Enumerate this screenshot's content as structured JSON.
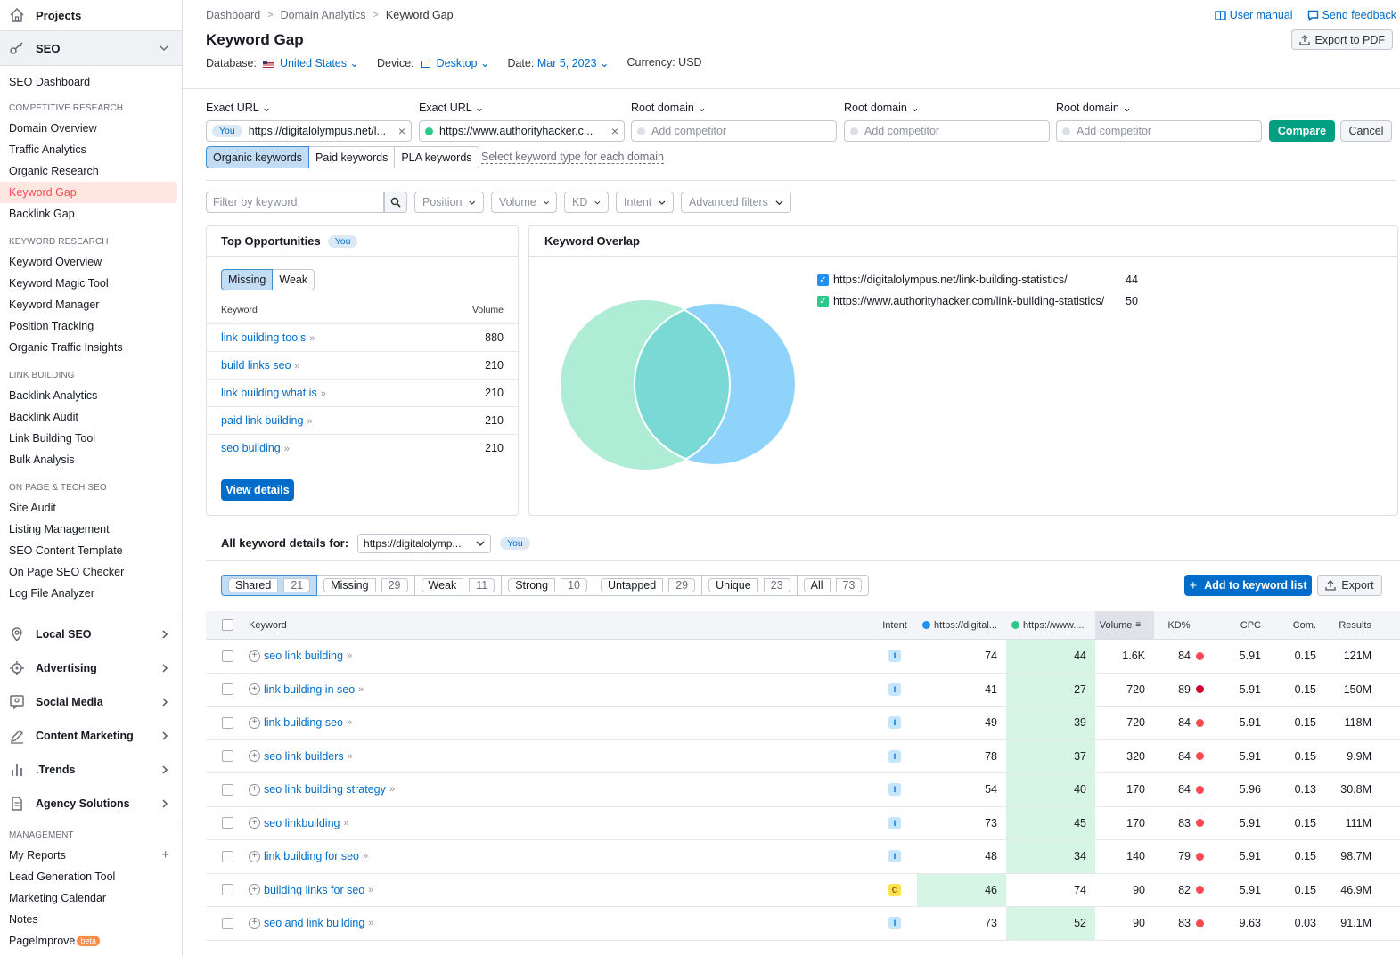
{
  "sidebar": {
    "projects": "Projects",
    "seo": "SEO",
    "seo_dashboard": "SEO Dashboard",
    "sections": [
      {
        "head": "COMPETITIVE RESEARCH",
        "items": [
          "Domain Overview",
          "Traffic Analytics",
          "Organic Research",
          "Keyword Gap",
          "Backlink Gap"
        ]
      },
      {
        "head": "KEYWORD RESEARCH",
        "items": [
          "Keyword Overview",
          "Keyword Magic Tool",
          "Keyword Manager",
          "Position Tracking",
          "Organic Traffic Insights"
        ]
      },
      {
        "head": "LINK BUILDING",
        "items": [
          "Backlink Analytics",
          "Backlink Audit",
          "Link Building Tool",
          "Bulk Analysis"
        ]
      },
      {
        "head": "ON PAGE & TECH SEO",
        "items": [
          "Site Audit",
          "Listing Management",
          "SEO Content Template",
          "On Page SEO Checker",
          "Log File Analyzer"
        ]
      }
    ],
    "categories": [
      {
        "label": "Local SEO",
        "icon": "location-pin-icon"
      },
      {
        "label": "Advertising",
        "icon": "target-icon"
      },
      {
        "label": "Social Media",
        "icon": "chat-bubble-icon"
      },
      {
        "label": "Content Marketing",
        "icon": "pencil-icon"
      },
      {
        "label": ".Trends",
        "icon": "bar-chart-icon"
      },
      {
        "label": "Agency Solutions",
        "icon": "document-icon"
      }
    ],
    "management_head": "MANAGEMENT",
    "management": [
      "My Reports",
      "Lead Generation Tool",
      "Marketing Calendar",
      "Notes",
      "PageImprove"
    ],
    "beta": "beta"
  },
  "breadcrumb": [
    "Dashboard",
    "Domain Analytics",
    "Keyword Gap"
  ],
  "toplinks": {
    "manual": "User manual",
    "feedback": "Send feedback"
  },
  "title": "Keyword Gap",
  "export_pdf": "Export to PDF",
  "meta": {
    "database_label": "Database:",
    "database": "United States",
    "device_label": "Device:",
    "device": "Desktop",
    "date_label": "Date:",
    "date": "Mar 5, 2023",
    "currency": "Currency: USD"
  },
  "domains": {
    "labels": [
      "Exact URL",
      "Exact URL",
      "Root domain",
      "Root domain",
      "Root domain"
    ],
    "you": "You",
    "url1": "https://digitalolympus.net/l...",
    "url2": "https://www.authorityhacker.c...",
    "placeholder": "Add competitor",
    "compare": "Compare",
    "cancel": "Cancel"
  },
  "kw_types": [
    "Organic keywords",
    "Paid keywords",
    "PLA keywords"
  ],
  "kw_select": "Select keyword type for each domain",
  "filters": {
    "placeholder": "Filter by keyword",
    "dropdowns": [
      "Position",
      "Volume",
      "KD",
      "Intent",
      "Advanced filters"
    ]
  },
  "opportunities": {
    "title": "Top Opportunities",
    "you": "You",
    "tabs": [
      "Missing",
      "Weak"
    ],
    "col_keyword": "Keyword",
    "col_volume": "Volume",
    "rows": [
      {
        "kw": "link building tools",
        "vol": "880"
      },
      {
        "kw": "build links seo",
        "vol": "210"
      },
      {
        "kw": "link building what is",
        "vol": "210"
      },
      {
        "kw": "paid link building",
        "vol": "210"
      },
      {
        "kw": "seo building",
        "vol": "210"
      }
    ],
    "view_details": "View details"
  },
  "overlap": {
    "title": "Keyword Overlap",
    "legend": [
      {
        "url": "https://digitalolympus.net/link-building-statistics/",
        "count": "44",
        "color": "#1f8ff0"
      },
      {
        "url": "https://www.authorityhacker.com/link-building-statistics/",
        "count": "50",
        "color": "#2cc98a"
      }
    ],
    "colors": {
      "a": "#aeecd5",
      "b": "#8fd3fb",
      "ab": "#7ad9d4"
    }
  },
  "details": {
    "label": "All keyword details for:",
    "select": "https://digitalolymp...",
    "you": "You",
    "tabs": [
      {
        "label": "Shared",
        "count": "21"
      },
      {
        "label": "Missing",
        "count": "29"
      },
      {
        "label": "Weak",
        "count": "11"
      },
      {
        "label": "Strong",
        "count": "10"
      },
      {
        "label": "Untapped",
        "count": "29"
      },
      {
        "label": "Unique",
        "count": "23"
      },
      {
        "label": "All",
        "count": "73"
      }
    ],
    "add_to_list": "Add to keyword list",
    "export": "Export"
  },
  "table": {
    "headers": {
      "keyword": "Keyword",
      "intent": "Intent",
      "u1": "https://digital...",
      "u2": "https://www....",
      "volume": "Volume",
      "kd": "KD%",
      "cpc": "CPC",
      "com": "Com.",
      "results": "Results"
    },
    "rows": [
      {
        "kw": "seo link building",
        "intent": "I",
        "u1": "74",
        "u2": "44",
        "best": "u2",
        "vol": "1.6K",
        "kd": "84",
        "kd_color": "#ff4953",
        "cpc": "5.91",
        "com": "0.15",
        "res": "121M"
      },
      {
        "kw": "link building in seo",
        "intent": "I",
        "u1": "41",
        "u2": "27",
        "best": "u2",
        "vol": "720",
        "kd": "89",
        "kd_color": "#d1002f",
        "cpc": "5.91",
        "com": "0.15",
        "res": "150M"
      },
      {
        "kw": "link building seo",
        "intent": "I",
        "u1": "49",
        "u2": "39",
        "best": "u2",
        "vol": "720",
        "kd": "84",
        "kd_color": "#ff4953",
        "cpc": "5.91",
        "com": "0.15",
        "res": "118M"
      },
      {
        "kw": "seo link builders",
        "intent": "I",
        "u1": "78",
        "u2": "37",
        "best": "u2",
        "vol": "320",
        "kd": "84",
        "kd_color": "#ff4953",
        "cpc": "5.91",
        "com": "0.15",
        "res": "9.9M"
      },
      {
        "kw": "seo link building strategy",
        "intent": "I",
        "u1": "54",
        "u2": "40",
        "best": "u2",
        "vol": "170",
        "kd": "84",
        "kd_color": "#ff4953",
        "cpc": "5.96",
        "com": "0.13",
        "res": "30.8M"
      },
      {
        "kw": "seo linkbuilding",
        "intent": "I",
        "u1": "73",
        "u2": "45",
        "best": "u2",
        "vol": "170",
        "kd": "83",
        "kd_color": "#ff4953",
        "cpc": "5.91",
        "com": "0.15",
        "res": "111M"
      },
      {
        "kw": "link building for seo",
        "intent": "I",
        "u1": "48",
        "u2": "34",
        "best": "u2",
        "vol": "140",
        "kd": "79",
        "kd_color": "#ff4953",
        "cpc": "5.91",
        "com": "0.15",
        "res": "98.7M"
      },
      {
        "kw": "building links for seo",
        "intent": "C",
        "u1": "46",
        "u2": "74",
        "best": "u1",
        "vol": "90",
        "kd": "82",
        "kd_color": "#ff4953",
        "cpc": "5.91",
        "com": "0.15",
        "res": "46.9M"
      },
      {
        "kw": "seo and link building",
        "intent": "I",
        "u1": "73",
        "u2": "52",
        "best": "u2",
        "vol": "90",
        "kd": "83",
        "kd_color": "#ff4953",
        "cpc": "9.63",
        "com": "0.03",
        "res": "91.1M"
      }
    ]
  }
}
